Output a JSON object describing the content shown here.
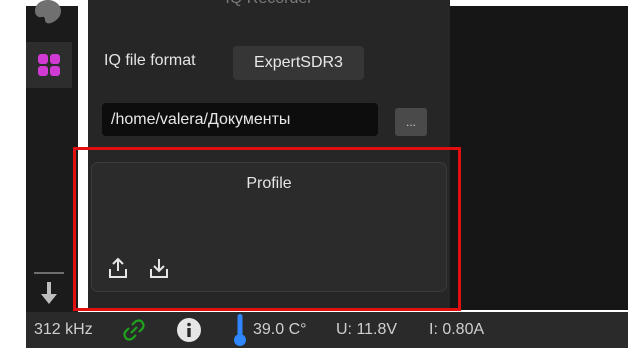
{
  "panel": {
    "title": "IQ Recorder",
    "format_label": "IQ file format",
    "format_value": "ExpertSDR3",
    "path_value": "/home/valera/Документы",
    "browse_label": "..."
  },
  "profile": {
    "title": "Profile",
    "icons": [
      "upload-icon",
      "download-icon"
    ]
  },
  "sidebar": {
    "icons": [
      "palette-icon",
      "apps-grid-icon",
      "download-arrow-icon"
    ],
    "accent_color": "#d13bd4"
  },
  "status": {
    "frequency": "312 kHz",
    "temperature": "39.0 C°",
    "voltage": "U: 11.8V",
    "current": "I: 0.80A",
    "link_color": "#1fa31f",
    "thermo_color": "#2f86ff"
  },
  "highlight_color": "#e10f0f"
}
